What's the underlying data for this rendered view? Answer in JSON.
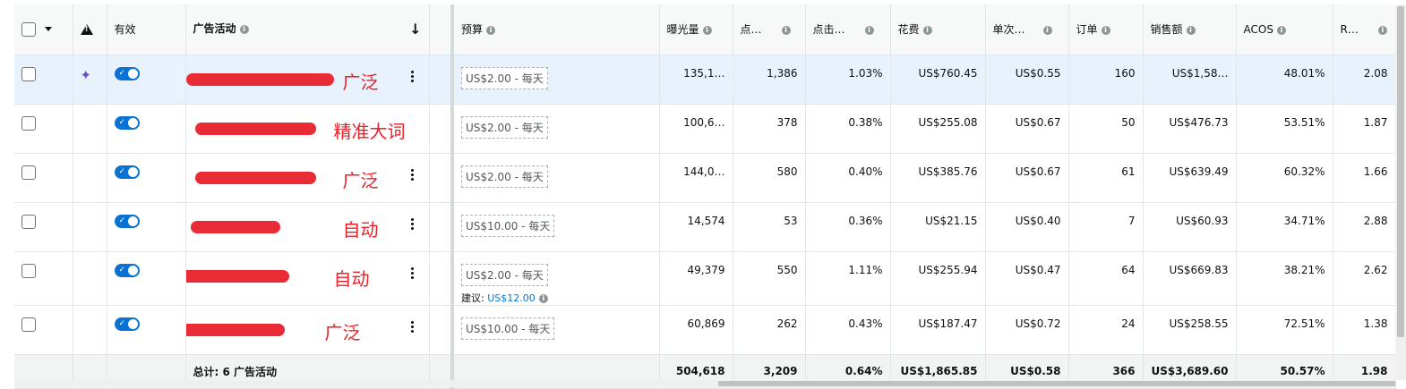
{
  "header": {
    "valid": "有效",
    "campaign": "广告活动",
    "budget": "预算",
    "impressions": "曝光量",
    "clicks": "点…",
    "ctr": "点击…",
    "spend": "花费",
    "cpc": "单次…",
    "orders": "订单",
    "sales": "销售额",
    "acos": "ACOS",
    "roas": "R…"
  },
  "rows": [
    {
      "note": "广泛",
      "budget": "US$2.00 - 每天",
      "impressions": "135,1…",
      "clicks": "1,386",
      "ctr": "1.03%",
      "spend": "US$760.45",
      "cpc": "US$0.55",
      "orders": "160",
      "sales": "US$1,58…",
      "acos": "48.01%",
      "roas": "2.08",
      "selected": true,
      "sparkle": true
    },
    {
      "note": "精准大词",
      "budget": "US$2.00 - 每天",
      "impressions": "100,6…",
      "clicks": "378",
      "ctr": "0.38%",
      "spend": "US$255.08",
      "cpc": "US$0.67",
      "orders": "50",
      "sales": "US$476.73",
      "acos": "53.51%",
      "roas": "1.87"
    },
    {
      "note": "广泛",
      "budget": "US$2.00 - 每天",
      "impressions": "144,0…",
      "clicks": "580",
      "ctr": "0.40%",
      "spend": "US$385.76",
      "cpc": "US$0.67",
      "orders": "61",
      "sales": "US$639.49",
      "acos": "60.32%",
      "roas": "1.66"
    },
    {
      "note": "自动",
      "budget": "US$10.00 - 每天",
      "impressions": "14,574",
      "clicks": "53",
      "ctr": "0.36%",
      "spend": "US$21.15",
      "cpc": "US$0.40",
      "orders": "7",
      "sales": "US$60.93",
      "acos": "34.71%",
      "roas": "2.88"
    },
    {
      "note": "自动",
      "budget": "US$2.00 - 每天",
      "suggest_label": "建议:",
      "suggest_value": "US$12.00",
      "impressions": "49,379",
      "clicks": "550",
      "ctr": "1.11%",
      "spend": "US$255.94",
      "cpc": "US$0.47",
      "orders": "64",
      "sales": "US$669.83",
      "acos": "38.21%",
      "roas": "2.62"
    },
    {
      "note": "广泛",
      "budget": "US$10.00 - 每天",
      "impressions": "60,869",
      "clicks": "262",
      "ctr": "0.43%",
      "spend": "US$187.47",
      "cpc": "US$0.72",
      "orders": "24",
      "sales": "US$258.55",
      "acos": "72.51%",
      "roas": "1.38"
    }
  ],
  "total": {
    "label": "总计: 6 广告活动",
    "impressions": "504,618",
    "clicks": "3,209",
    "ctr": "0.64%",
    "spend": "US$1,865.85",
    "cpc": "US$0.58",
    "orders": "366",
    "sales": "US$3,689.60",
    "acos": "50.57%",
    "roas": "1.98"
  },
  "colors": {
    "accent": "#0972d3",
    "annotation": "#e8202a",
    "selected_row": "#e8f2fc"
  }
}
